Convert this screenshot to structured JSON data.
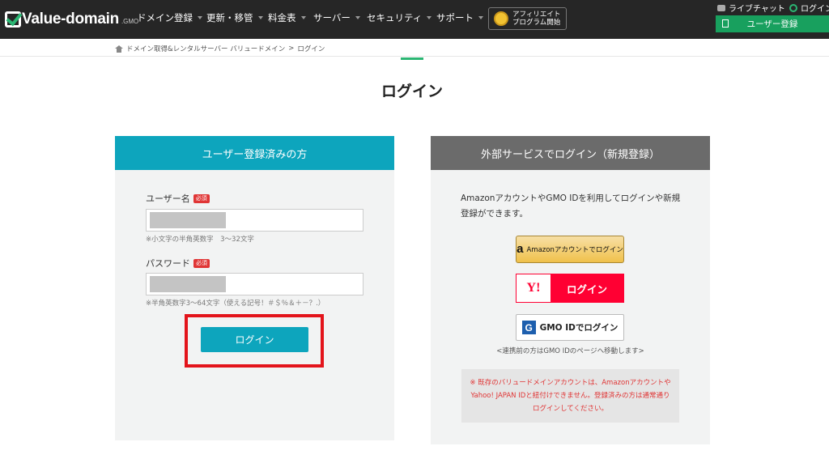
{
  "header": {
    "logo": {
      "text": "Value-domain",
      "suffix": ".GMO"
    },
    "nav": [
      {
        "label": "ドメイン登録"
      },
      {
        "label": "更新・移管"
      },
      {
        "label": "料金表"
      },
      {
        "label": "サーバー"
      },
      {
        "label": "セキュリティ"
      },
      {
        "label": "サポート"
      }
    ],
    "affiliate": {
      "line1": "アフィリエイト",
      "line2": "プログラム開始"
    },
    "live_chat": "ライブチャット",
    "login_link": "ログイン",
    "signup": "ユーザー登録"
  },
  "breadcrumb": {
    "home": "ドメイン取得&レンタルサーバー バリュードメイン",
    "separator": ">",
    "current": "ログイン"
  },
  "page_title": "ログイン",
  "registered_user": {
    "heading": "ユーザー登録済みの方",
    "username": {
      "label": "ユーザー名",
      "required": "必須",
      "hint": "※小文字の半角英数字　3〜32文字"
    },
    "password": {
      "label": "パスワード",
      "required": "必須",
      "hint": "※半角英数字3〜64文字（使える記号！＃＄％＆＋－？.）"
    },
    "login_button": "ログイン"
  },
  "external_login": {
    "heading": "外部サービスでログイン（新規登録）",
    "description": "AmazonアカウントやGMO IDを利用してログインや新規登録ができます。",
    "amazon": {
      "icon": "a",
      "label": "Amazonアカウントでログイン"
    },
    "yahoo": {
      "logo": "Y!",
      "label": "ログイン"
    },
    "gmo": {
      "icon": "G",
      "label": "GMO IDでログイン"
    },
    "gmo_note": "<連携前の方はGMO IDのページへ移動します>",
    "notice": "※ 既存のバリュードメインアカウントは、AmazonアカウントやYahoo! JAPAN IDと紐付けできません。登録済みの方は通常通りログインしてください。"
  },
  "colors": {
    "brand_green": "#2bb673",
    "teal": "#0da5bd",
    "highlight_red": "#e3141b",
    "yahoo_red": "#ff0033",
    "amazon_yellow": "#f0c14b"
  }
}
